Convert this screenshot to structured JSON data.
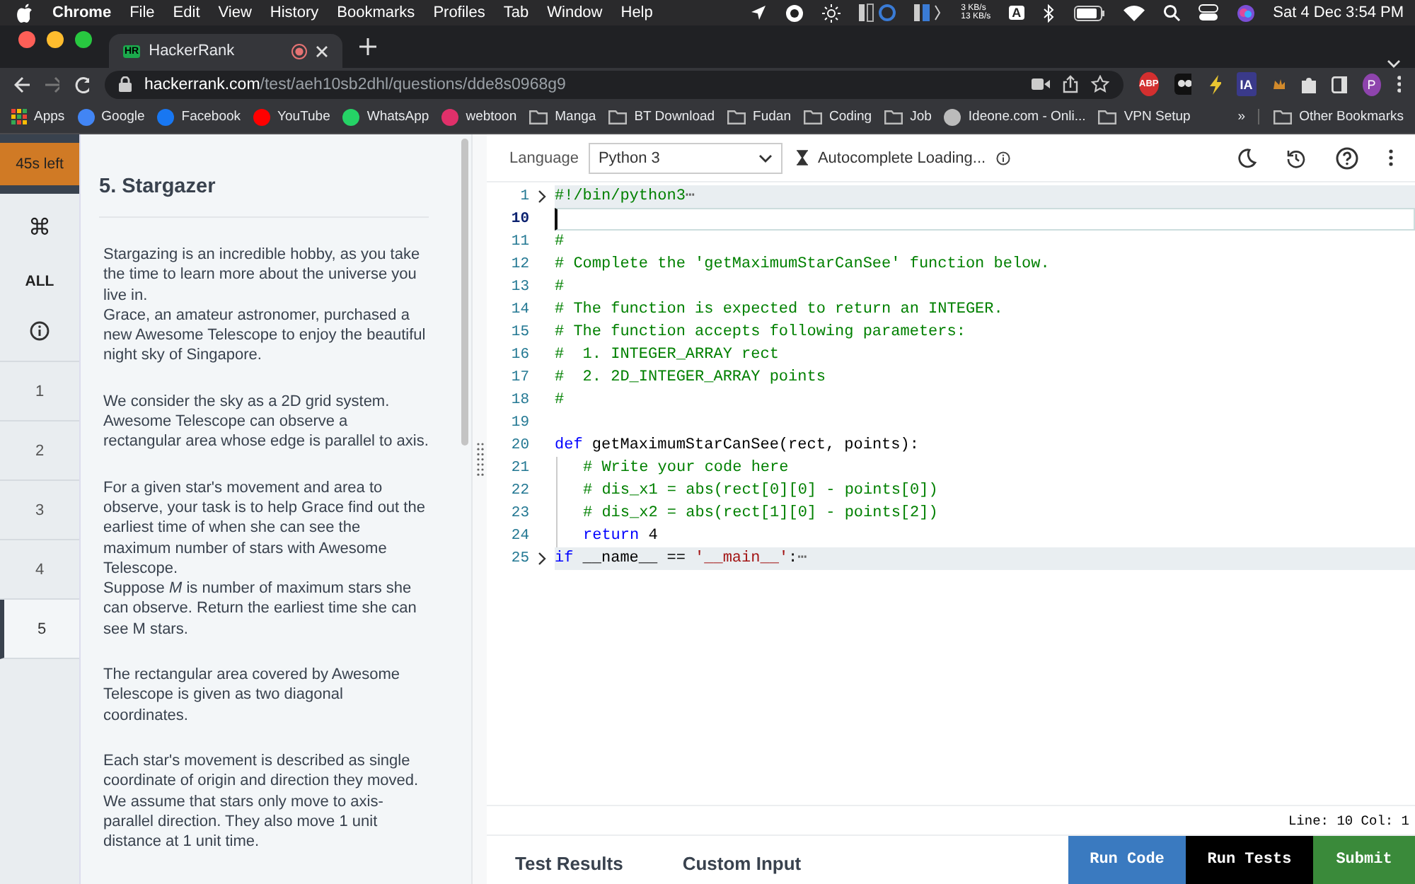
{
  "menu_bar": {
    "app": "Chrome",
    "items": [
      "File",
      "Edit",
      "View",
      "History",
      "Bookmarks",
      "Profiles",
      "Tab",
      "Window",
      "Help"
    ],
    "net_up": "3 KB/s",
    "net_down": "13 KB/s",
    "input_source": "A",
    "clock": "Sat 4 Dec  3:54 PM"
  },
  "browser": {
    "tab": {
      "title": "HackerRank",
      "favicon": "HR"
    },
    "address": {
      "host": "hackerrank.com",
      "path": "/test/aeh10sb2dhl/questions/dde8s0968g9"
    },
    "extensions": [
      "ABP",
      "IA"
    ],
    "profile": "P",
    "bookmarks": [
      {
        "label": "Apps",
        "kind": "apps"
      },
      {
        "label": "Google",
        "kind": "google"
      },
      {
        "label": "Facebook",
        "kind": "facebook"
      },
      {
        "label": "YouTube",
        "kind": "youtube"
      },
      {
        "label": "WhatsApp",
        "kind": "whatsapp"
      },
      {
        "label": "webtoon",
        "kind": "webtoon"
      },
      {
        "label": "Manga",
        "kind": "folder"
      },
      {
        "label": "BT Download",
        "kind": "folder"
      },
      {
        "label": "Fudan",
        "kind": "folder"
      },
      {
        "label": "Coding",
        "kind": "folder"
      },
      {
        "label": "Job",
        "kind": "folder"
      },
      {
        "label": "Ideone.com - Onli...",
        "kind": "site"
      },
      {
        "label": "VPN Setup",
        "kind": "folder"
      }
    ],
    "overflow": "»",
    "other_bookmarks": "Other Bookmarks"
  },
  "nav": {
    "timer": "45s left",
    "shortcut": "⌘",
    "all": "ALL",
    "questions": [
      {
        "label": "1",
        "selected": false
      },
      {
        "label": "2",
        "selected": false
      },
      {
        "label": "3",
        "selected": false
      },
      {
        "label": "4",
        "selected": false
      },
      {
        "label": "5",
        "selected": true
      }
    ]
  },
  "problem": {
    "title": "5. Stargazer",
    "paragraphs": [
      "Stargazing is an incredible hobby, as you take the time to learn more about the universe you live in.\nGrace, an amateur astronomer, purchased a new Awesome Telescope to enjoy the beautiful night sky of Singapore.",
      "We consider the sky as a 2D grid system. Awesome Telescope can observe a rectangular area whose edge is parallel to axis.",
      "For a given star's movement and area to observe, your task is to help Grace find out the earliest time of when she can see the maximum number of stars with Awesome Telescope.\nSuppose *M* is number of maximum stars she can observe. Return the earliest time she can see M stars.",
      "The rectangular area covered by Awesome Telescope is given as two diagonal coordinates.",
      "Each star's movement is described as single coordinate of origin and direction they moved. We assume that stars only move to axis-parallel direction. They also move 1 unit distance at 1 unit time."
    ]
  },
  "editor": {
    "language_label": "Language",
    "language": "Python 3",
    "autocomplete": "Autocomplete Loading...",
    "lines": [
      {
        "number": "1",
        "folded": true,
        "active": false,
        "tokens": [
          {
            "kind": "comment",
            "text": "#!/bin/python3"
          }
        ]
      },
      {
        "number": "10",
        "folded": false,
        "active": true
      },
      {
        "number": "11",
        "folded": false,
        "active": false,
        "tokens": [
          {
            "kind": "comment",
            "text": "#"
          }
        ]
      },
      {
        "number": "12",
        "folded": false,
        "active": false,
        "tokens": [
          {
            "kind": "comment",
            "text": "# Complete the 'getMaximumStarCanSee' function below."
          }
        ]
      },
      {
        "number": "13",
        "folded": false,
        "active": false,
        "tokens": [
          {
            "kind": "comment",
            "text": "#"
          }
        ]
      },
      {
        "number": "14",
        "folded": false,
        "active": false,
        "tokens": [
          {
            "kind": "comment",
            "text": "# The function is expected to return an INTEGER."
          }
        ]
      },
      {
        "number": "15",
        "folded": false,
        "active": false,
        "tokens": [
          {
            "kind": "comment",
            "text": "# The function accepts following parameters:"
          }
        ]
      },
      {
        "number": "16",
        "folded": false,
        "active": false,
        "tokens": [
          {
            "kind": "comment",
            "text": "#  1. INTEGER_ARRAY rect"
          }
        ]
      },
      {
        "number": "17",
        "folded": false,
        "active": false,
        "tokens": [
          {
            "kind": "comment",
            "text": "#  2. 2D_INTEGER_ARRAY points"
          }
        ]
      },
      {
        "number": "18",
        "folded": false,
        "active": false,
        "tokens": [
          {
            "kind": "comment",
            "text": "#"
          }
        ]
      },
      {
        "number": "19",
        "folded": false,
        "active": false
      },
      {
        "number": "20",
        "folded": false,
        "active": false,
        "tokens": [
          {
            "kind": "keyword",
            "text": "def"
          },
          {
            "kind": "plain",
            "text": " getMaximumStarCanSee(rect, points):"
          }
        ]
      },
      {
        "number": "21",
        "folded": false,
        "active": false,
        "indented": true,
        "tokens": [
          {
            "kind": "comment",
            "text": "# Write your code here"
          }
        ]
      },
      {
        "number": "22",
        "folded": false,
        "active": false,
        "indented": true,
        "tokens": [
          {
            "kind": "comment",
            "text": "# dis_x1 = abs(rect[0][0] - points[0])"
          }
        ]
      },
      {
        "number": "23",
        "folded": false,
        "active": false,
        "indented": true,
        "tokens": [
          {
            "kind": "comment",
            "text": "# dis_x2 = abs(rect[1][0] - points[2])"
          }
        ]
      },
      {
        "number": "24",
        "folded": false,
        "active": false,
        "indented": true,
        "tokens": [
          {
            "kind": "keyword",
            "text": "return"
          },
          {
            "kind": "plain",
            "text": " 4"
          }
        ]
      },
      {
        "number": "25",
        "folded": true,
        "active": false,
        "tokens": [
          {
            "kind": "keyword",
            "text": "if"
          },
          {
            "kind": "plain",
            "text": " __name__ == "
          },
          {
            "kind": "string",
            "text": "'__main__'"
          },
          {
            "kind": "plain",
            "text": ":"
          }
        ]
      }
    ],
    "fold_mark": "⋯",
    "cursor": "Line: 10 Col: 1"
  },
  "bottom": {
    "tabs": [
      {
        "label": "Test Results",
        "selected": false
      },
      {
        "label": "Custom Input",
        "selected": false
      }
    ],
    "buttons": [
      {
        "label": "Run Code",
        "kind": "run"
      },
      {
        "label": "Run Tests",
        "kind": "tests"
      },
      {
        "label": "Submit",
        "kind": "submit"
      }
    ]
  }
}
